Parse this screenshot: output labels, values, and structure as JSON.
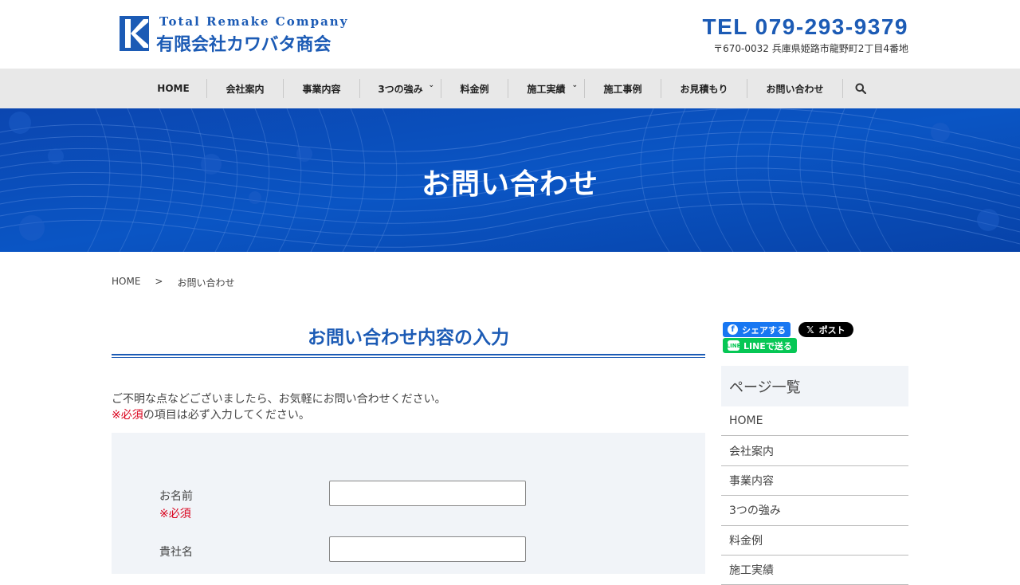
{
  "header": {
    "logo_en": "Total Remake Company",
    "logo_jp": "有限会社カワバタ商会",
    "tel": "TEL 079-293-9379",
    "address": "〒670-0032 兵庫県姫路市龍野町2丁目4番地",
    "brand_color": "#1c5bb5"
  },
  "nav": {
    "items": [
      {
        "label": "HOME",
        "has_submenu": false
      },
      {
        "label": "会社案内",
        "has_submenu": false
      },
      {
        "label": "事業内容",
        "has_submenu": false
      },
      {
        "label": "3つの強み",
        "has_submenu": true
      },
      {
        "label": "料金例",
        "has_submenu": false
      },
      {
        "label": "施工実績",
        "has_submenu": true
      },
      {
        "label": "施工事例",
        "has_submenu": false
      },
      {
        "label": "お見積もり",
        "has_submenu": false
      },
      {
        "label": "お問い合わせ",
        "has_submenu": false
      }
    ],
    "search_icon": "search-icon"
  },
  "hero": {
    "title": "お問い合わせ"
  },
  "breadcrumb": {
    "home": "HOME",
    "separator": ">",
    "current": "お問い合わせ"
  },
  "main": {
    "title": "お問い合わせ内容の入力",
    "intro_line1": "ご不明な点などございましたら、お気軽にお問い合わせください。",
    "required_mark": "※必須",
    "intro_line2_rest": "の項目は必ず入力してください。",
    "form": {
      "name_label": "お名前",
      "name_required": "※必須",
      "name_value": "",
      "company_label": "貴社名",
      "company_value": ""
    }
  },
  "sidebar": {
    "share": {
      "facebook": "シェアする",
      "x": "ポスト",
      "line": "LINEで送る"
    },
    "heading": "ページ一覧",
    "items": [
      "HOME",
      "会社案内",
      "事業内容",
      "3つの強み",
      "料金例",
      "施工実績"
    ]
  }
}
